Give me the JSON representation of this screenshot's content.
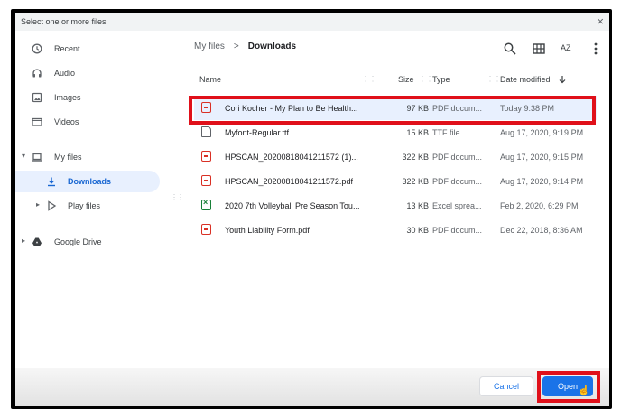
{
  "dialog": {
    "title": "Select one or more files",
    "close_symbol": "×"
  },
  "sidebar": {
    "items": [
      {
        "label": "Recent",
        "icon": "clock-icon"
      },
      {
        "label": "Audio",
        "icon": "headphones-icon"
      },
      {
        "label": "Images",
        "icon": "image-icon"
      },
      {
        "label": "Videos",
        "icon": "video-icon"
      },
      {
        "label": "My files",
        "icon": "laptop-icon"
      },
      {
        "label": "Downloads",
        "icon": "download-icon"
      },
      {
        "label": "Play files",
        "icon": "play-icon"
      },
      {
        "label": "Google Drive",
        "icon": "drive-icon"
      }
    ]
  },
  "breadcrumb": {
    "root": "My files",
    "separator": ">",
    "current": "Downloads"
  },
  "toolbar": {
    "sort_label": "AZ"
  },
  "table": {
    "headers": {
      "name": "Name",
      "size": "Size",
      "type": "Type",
      "date": "Date modified"
    },
    "rows": [
      {
        "name": "Cori Kocher - My Plan to Be Health...",
        "size": "97 KB",
        "type": "PDF docum...",
        "date": "Today 9:38 PM",
        "kind": "pdf"
      },
      {
        "name": "Myfont-Regular.ttf",
        "size": "15 KB",
        "type": "TTF file",
        "date": "Aug 17, 2020, 9:19 PM",
        "kind": "ttf"
      },
      {
        "name": "HPSCAN_20200818041211572 (1)...",
        "size": "322 KB",
        "type": "PDF docum...",
        "date": "Aug 17, 2020, 9:15 PM",
        "kind": "pdf"
      },
      {
        "name": "HPSCAN_20200818041211572.pdf",
        "size": "322 KB",
        "type": "PDF docum...",
        "date": "Aug 17, 2020, 9:14 PM",
        "kind": "pdf"
      },
      {
        "name": "2020 7th Volleyball Pre Season Tou...",
        "size": "13 KB",
        "type": "Excel sprea...",
        "date": "Feb 2, 2020, 6:29 PM",
        "kind": "xls"
      },
      {
        "name": "Youth Liability Form.pdf",
        "size": "30 KB",
        "type": "PDF docum...",
        "date": "Dec 22, 2018, 8:36 AM",
        "kind": "pdf"
      }
    ]
  },
  "footer": {
    "cancel_label": "Cancel",
    "open_label": "Open"
  },
  "colors": {
    "accent": "#1a73e8",
    "highlight": "#e0101a",
    "selected_row": "#e8f0fe"
  }
}
